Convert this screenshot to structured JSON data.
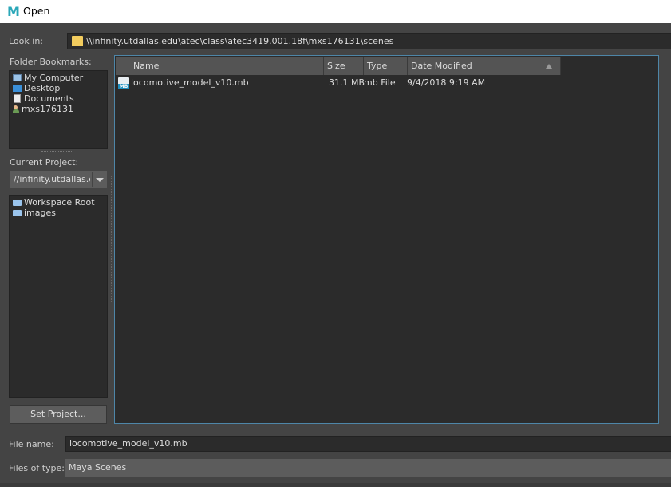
{
  "window": {
    "title": "Open",
    "app_icon": "maya-icon",
    "app_icon_letter": "M"
  },
  "look_in": {
    "label": "Look in:",
    "path": "\\\\infinity.utdallas.edu\\atec\\class\\atec3419.001.18f\\mxs176131\\scenes",
    "icon": "folder-icon"
  },
  "folder_bookmarks": {
    "label": "Folder Bookmarks:",
    "items": [
      {
        "label": "My Computer",
        "icon": "computer-icon"
      },
      {
        "label": "Desktop",
        "icon": "desktop-icon"
      },
      {
        "label": "Documents",
        "icon": "document-icon"
      },
      {
        "label": "mxs176131",
        "icon": "user-icon"
      }
    ]
  },
  "current_project": {
    "label": "Current Project:",
    "value": "//infinity.utdallas.e",
    "items": [
      {
        "label": "Workspace Root",
        "icon": "folder-icon"
      },
      {
        "label": "images",
        "icon": "folder-icon"
      }
    ],
    "set_button": "Set Project..."
  },
  "file_list": {
    "columns": [
      "Name",
      "Size",
      "Type",
      "Date Modified"
    ],
    "sort_column": "Date Modified",
    "rows": [
      {
        "name": "locomotive_model_v10.mb",
        "size": "31.1 MB",
        "type": "mb File",
        "date": "9/4/2018 9:19 AM",
        "icon": "mb-file-icon",
        "icon_badge": "MB"
      }
    ]
  },
  "file_name": {
    "label": "File name:",
    "value": "locomotive_model_v10.mb"
  },
  "files_of_type": {
    "label": "Files of type:",
    "value": "Maya Scenes"
  },
  "colors": {
    "background": "#444444",
    "panel": "#2b2b2b",
    "header": "#545454",
    "accent_border": "#4e86a8",
    "folder": "#f2cc5e",
    "mb_badge": "#1f8fbf"
  }
}
